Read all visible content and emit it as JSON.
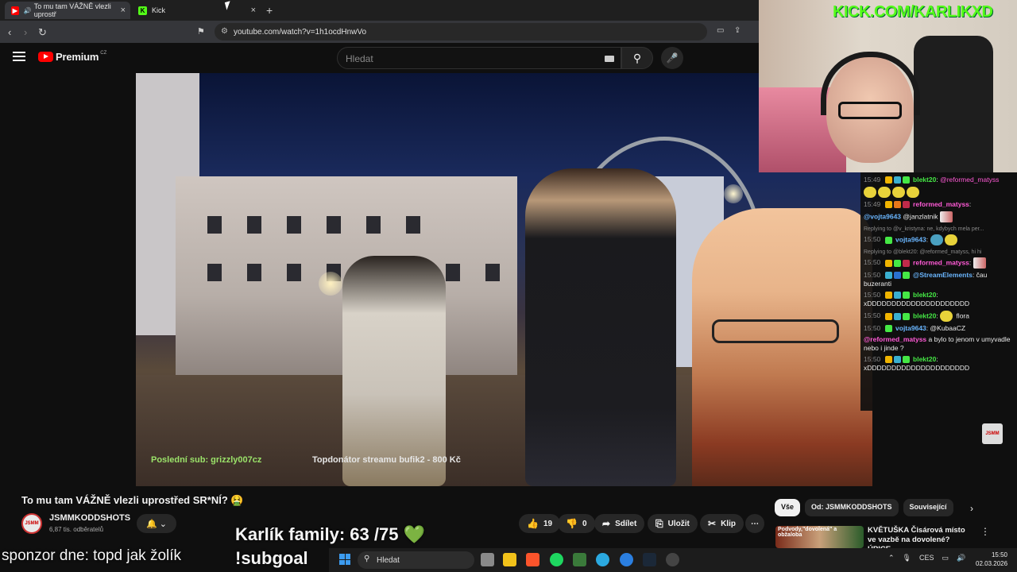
{
  "browser": {
    "tabs": [
      {
        "label": "To mu tam VÁŽNĚ vlezli uprostř",
        "favicon": "youtube-icon",
        "audio": "speaker-icon",
        "active": true
      },
      {
        "label": "Kick",
        "favicon": "kick-icon",
        "active": false
      }
    ],
    "url": "youtube.com/watch?v=1h1ocdHnwVo"
  },
  "youtube": {
    "logo_word": "Premium",
    "logo_region": "CZ",
    "search_placeholder": "Hledat",
    "video": {
      "overlay_last_sub": "Poslední sub: grizzly007cz",
      "overlay_top_donor": "Topdonátor streamu bufik2 - 800 Kč"
    },
    "title": "To mu tam VÁŽNĚ vlezli uprostřed SR*NÍ? 🤮",
    "channel": {
      "name": "JSMMKODDSHOTS",
      "subs": "6,87 tis. odběratelů",
      "avatar_text": "JSMM"
    },
    "actions": {
      "like_count": "19",
      "dislike_count": "0",
      "share": "Sdílet",
      "save": "Uložit",
      "clip": "Klip",
      "more": "⋯"
    },
    "chips": [
      "Vše",
      "Od: JSMMKODDSHOTS",
      "Související"
    ],
    "recommendation": {
      "thumb_text": "Podvody,\"dovolená\" a obžaloba",
      "title": "KVĚTUŠKA Čisárová místo ve vazbě na dovolené? ÚPICE, ..."
    }
  },
  "stream": {
    "kick_url": "KICK.COM/KARLIKXD",
    "family": "Karlík family: 63 /75",
    "heart": "💚",
    "subgoal": "!subgoal",
    "sponsor": "sponzor dne: topd jak žolík"
  },
  "chat": {
    "messages": [
      {
        "time": "15:49",
        "user": "blekt20",
        "user_color": "#45e845",
        "text": "@reformed_matyss",
        "mention_color": "#ff5ad6"
      },
      {
        "time": "",
        "user": "",
        "text": "",
        "emotes": 4
      },
      {
        "time": "15:49",
        "user": "reformed_matyss",
        "user_color": "#ff5ad6",
        "text": ""
      },
      {
        "time": "",
        "user": "@vojta9643",
        "user_color": "#6ab6ff",
        "text": "@janzlatnik"
      },
      {
        "reply": "Replying to @v_kristyna: ne, kdybych mela per..."
      },
      {
        "time": "15:50",
        "user": "vojta9643",
        "user_color": "#6ab6ff",
        "text": ""
      },
      {
        "reply": "Replying to @blekt20: @reformed_matyss, hi hi"
      },
      {
        "time": "15:50",
        "user": "reformed_matyss",
        "user_color": "#ff5ad6",
        "text": ""
      },
      {
        "time": "15:50",
        "user": "@StreamElements",
        "user_color": "#6ab6ff",
        "text": "čau buzeranti"
      },
      {
        "time": "15:50",
        "user": "blekt20",
        "user_color": "#45e845",
        "text": "xDDDDDDDDDDDDDDDDDDDDD"
      },
      {
        "time": "15:50",
        "user": "blekt20",
        "user_color": "#45e845",
        "text": "flora"
      },
      {
        "time": "15:50",
        "user": "vojta9643",
        "user_color": "#6ab6ff",
        "text": "@KubaaCZ"
      },
      {
        "time": "",
        "user": "@reformed_matyss",
        "user_color": "#ff5ad6",
        "text": "a bylo to jenom v umyvadle nebo i jinde ?"
      },
      {
        "time": "15:50",
        "user": "blekt20",
        "user_color": "#45e845",
        "text": "xDDDDDDDDDDDDDDDDDDDDD"
      }
    ]
  },
  "taskbar": {
    "search": "Hledat",
    "lang": "CES",
    "time": "15:50",
    "date": "02.03.2026"
  }
}
